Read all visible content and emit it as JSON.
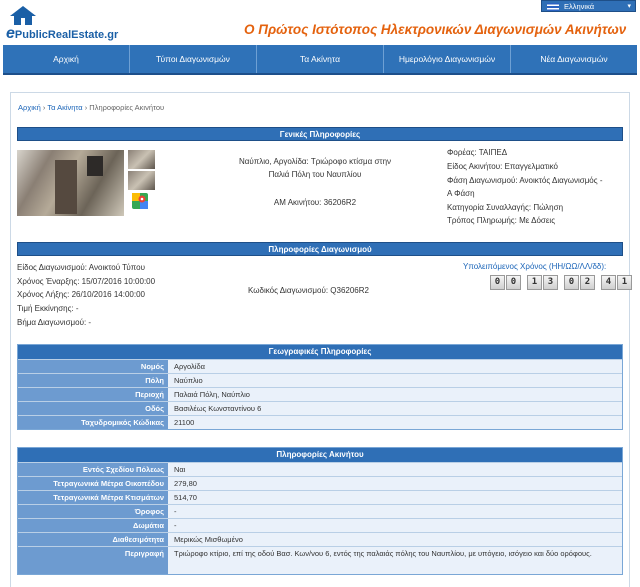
{
  "header": {
    "logo_text": "PublicRealEstate.gr",
    "logo_prefix": "e",
    "tagline": "Ο Πρώτος Ιστότοπος Ηλεκτρονικών Διαγωνισμών Ακινήτων",
    "language": "Ελληνικά"
  },
  "nav": [
    {
      "label": "Αρχική"
    },
    {
      "label": "Τύποι Διαγωνισμών"
    },
    {
      "label": "Τα Ακίνητα"
    },
    {
      "label": "Ημερολόγιο Διαγωνισμών"
    },
    {
      "label": "Νέα Διαγωνισμών"
    }
  ],
  "breadcrumb": {
    "home": "Αρχική",
    "sep1": " › ",
    "properties": "Τα Ακίνητα",
    "sep2": " › ",
    "current": "Πληροφορίες Ακινήτου"
  },
  "general": {
    "title": "Γενικές Πληροφορίες",
    "description_line1": "Ναύπλιο, Αργολίδα: Τριώροφο κτίσμα στην",
    "description_line2": "Παλιά Πόλη του Ναυπλίου",
    "am": "ΑΜ Ακινήτου: 36206R2",
    "fields": [
      {
        "label": "Φορέας:",
        "value": "ΤΑΙΠΕΔ"
      },
      {
        "label": "Είδος Ακινήτου:",
        "value": "Επαγγελματικό"
      },
      {
        "label": "Φάση Διαγωνισμού:",
        "value": "Ανοικτός Διαγωνισμός -"
      },
      {
        "label": "",
        "value": "Α Φάση"
      },
      {
        "label": "Κατηγορία Συναλλαγής:",
        "value": "Πώληση"
      },
      {
        "label": "Τρόπος Πληρωμής:",
        "value": "Με Δόσεις"
      }
    ]
  },
  "tender": {
    "title": "Πληροφορίες Διαγωνισμού",
    "fields": [
      {
        "label": "Είδος Διαγωνισμού:",
        "value": "Ανοικτού Τύπου"
      },
      {
        "label": "Χρόνος Έναρξης:",
        "value": "15/07/2016 10:00:00"
      },
      {
        "label": "Χρόνος Λήξης:",
        "value": "26/10/2016 14:00:00"
      },
      {
        "label": "Τιμή Εκκίνησης:",
        "value": "-"
      },
      {
        "label": "Βήμα Διαγωνισμού:",
        "value": "-"
      }
    ],
    "code": "Κωδικός Διαγωνισμού: Q36206R2",
    "timer_label": "Υπολειπόμενος Χρόνος (ΗΗ/ΩΩ/ΛΛ/δδ):",
    "timer_digits": [
      "0",
      "0",
      "1",
      "3",
      "0",
      "2",
      "4",
      "1"
    ]
  },
  "geo": {
    "title": "Γεωγραφικές Πληροφορίες",
    "rows": [
      {
        "key": "Νομός",
        "value": "Αργολίδα"
      },
      {
        "key": "Πόλη",
        "value": "Ναύπλιο"
      },
      {
        "key": "Περιοχή",
        "value": "Παλαιά Πόλη, Ναύπλιο"
      },
      {
        "key": "Οδός",
        "value": "Βασιλέως Κωνσταντίνου 6"
      },
      {
        "key": "Ταχυδρομικός Κώδικας",
        "value": "21100"
      }
    ]
  },
  "property": {
    "title": "Πληροφορίες Ακινήτου",
    "rows": [
      {
        "key": "Εντός Σχεδίου Πόλεως",
        "value": "Ναι"
      },
      {
        "key": "Τετραγωνικά Μέτρα Οικοπέδου",
        "value": "279,80"
      },
      {
        "key": "Τετραγωνικά Μέτρα Κτισμάτων",
        "value": "514,70"
      },
      {
        "key": "Όροφος",
        "value": "-"
      },
      {
        "key": "Δωμάτια",
        "value": "-"
      },
      {
        "key": "Διαθεσιμότητα",
        "value": "Μερικώς Μισθωμένο"
      },
      {
        "key": "Περιγραφή",
        "value": "Τριώροφο κτίριο, επί της οδού Βασ. Κων/νου 6, εντός της παλαιάς πόλης του Ναυπλίου, με υπόγειο, ισόγειο και δύο ορόφους."
      }
    ]
  }
}
